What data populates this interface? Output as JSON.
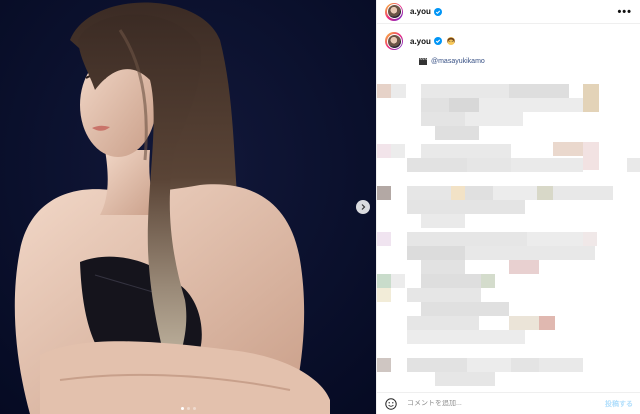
{
  "post": {
    "username": "a.you",
    "verified_icon": "verified-badge-icon",
    "more_icon": "more-options-icon",
    "caption_emoji_icon": "woman-emoji-icon",
    "mention_icon": "clapperboard-emoji-icon",
    "mention": "@masayukikamo"
  },
  "media": {
    "next_icon": "chevron-right-icon",
    "slide_count": 3,
    "active_slide": 1
  },
  "footer": {
    "emoji_icon": "smile-icon",
    "comment_placeholder": "コメントを追加...",
    "post_label": "投稿する"
  },
  "colors": {
    "accent": "#0095f6",
    "post_disabled": "#b2dffc",
    "mention": "#385185",
    "photo_bg": "#0a0f2a"
  }
}
